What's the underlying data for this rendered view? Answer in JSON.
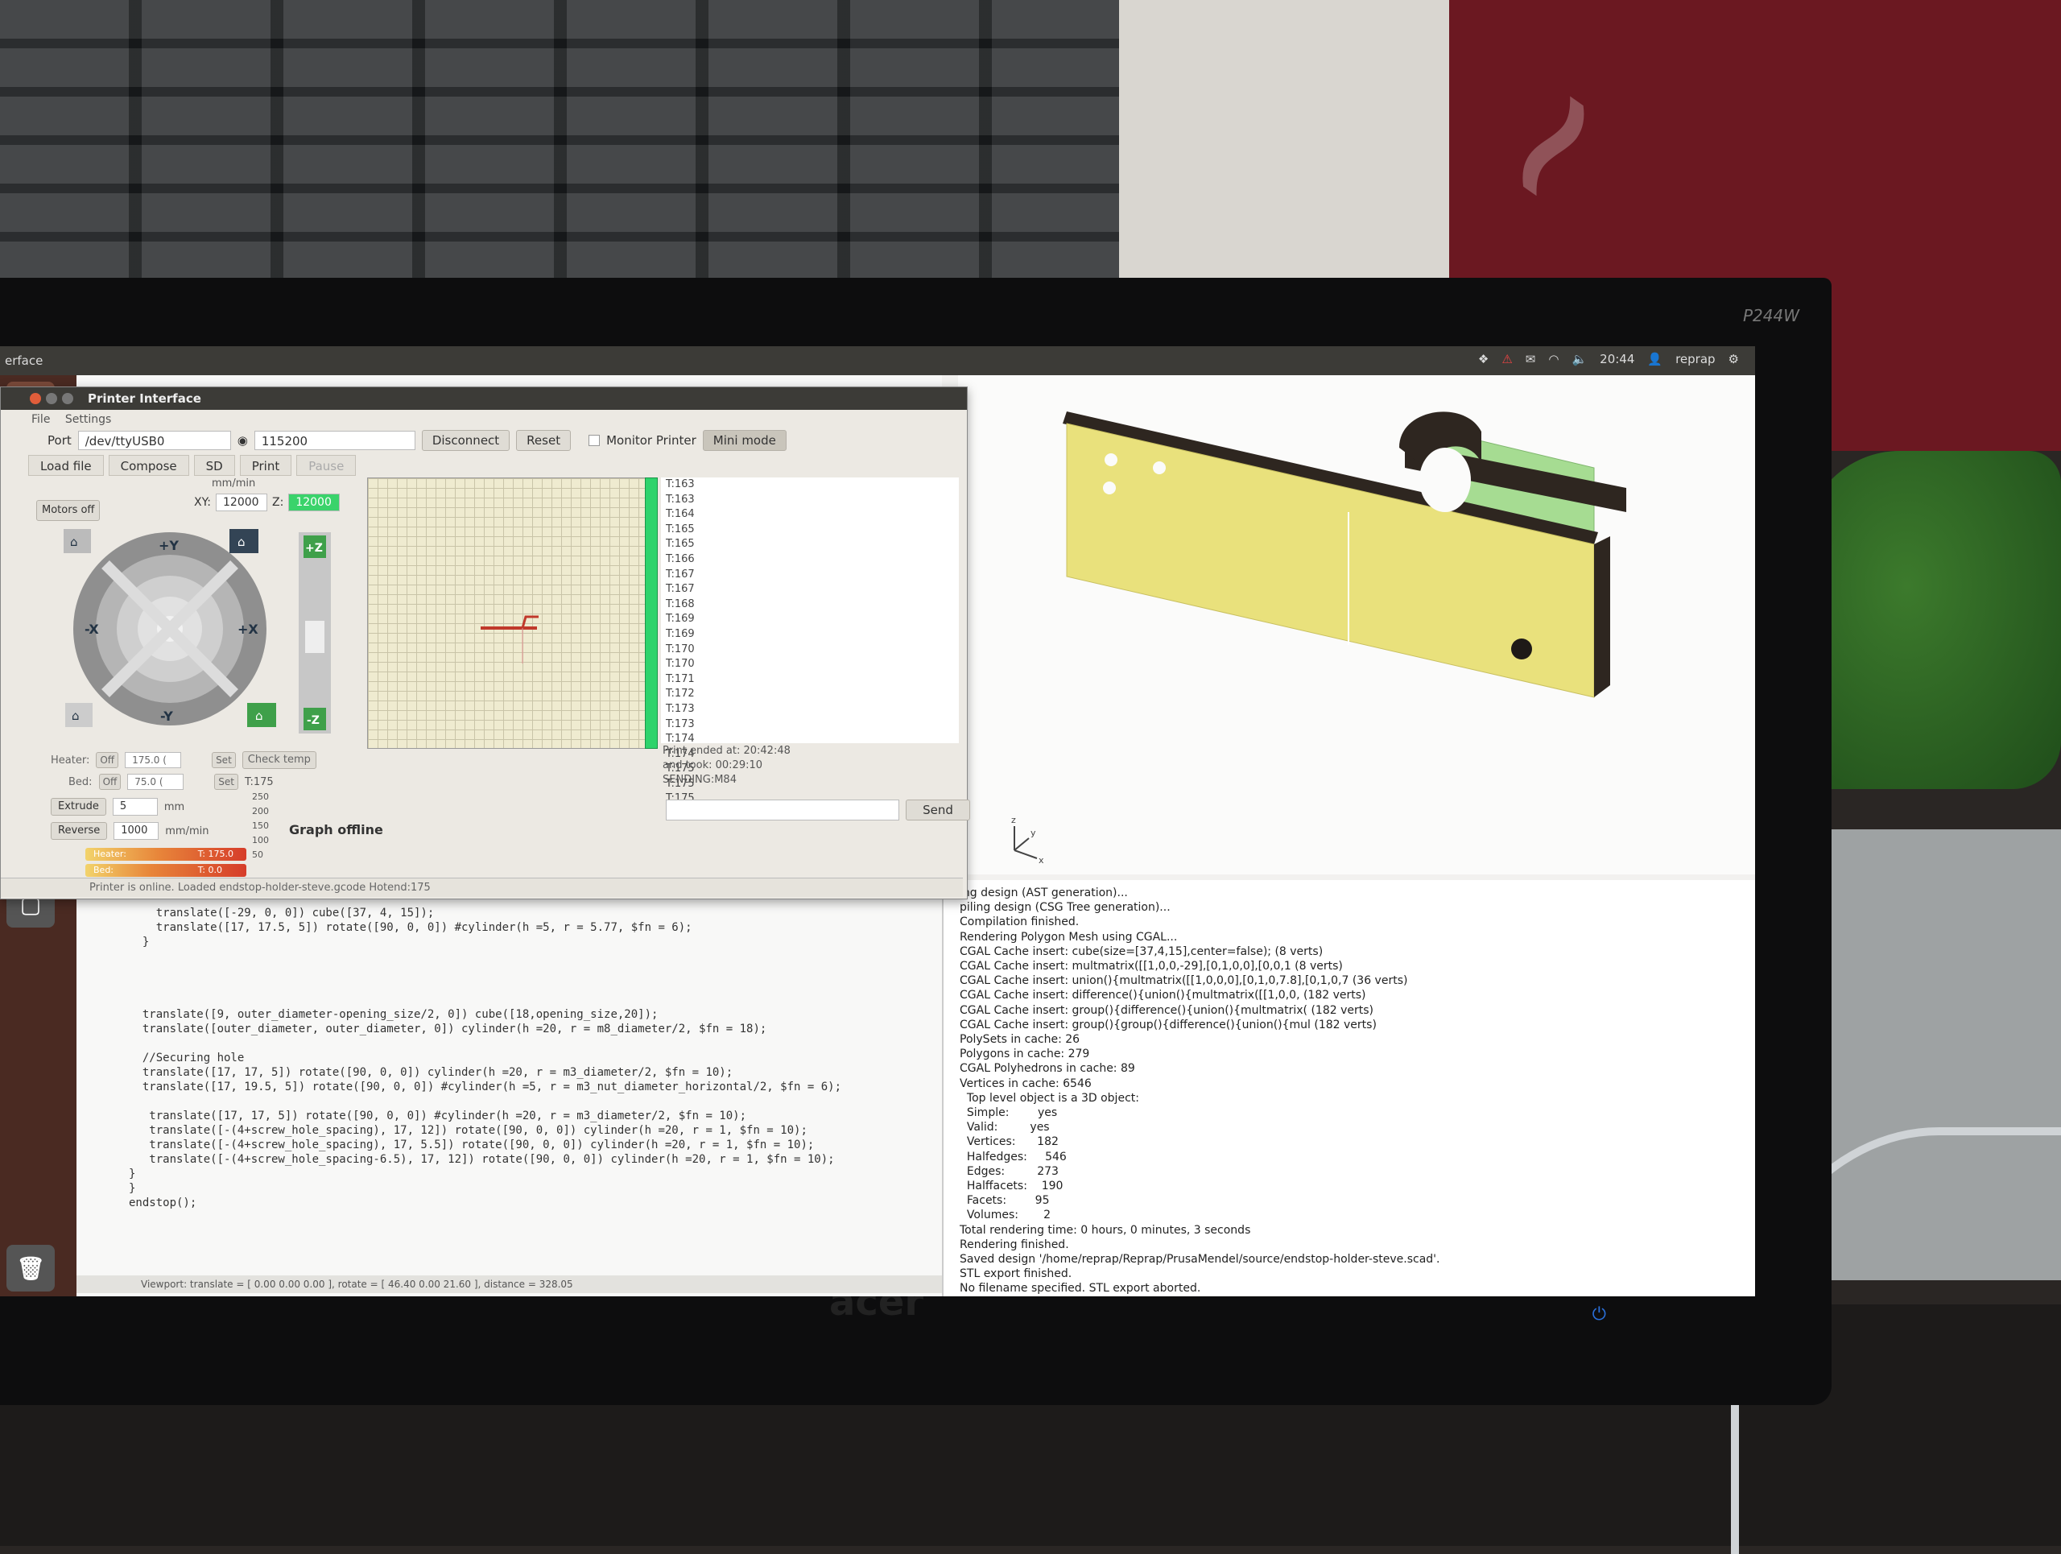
{
  "top_panel": {
    "title": "erface",
    "clock": "20:44",
    "user": "reprap"
  },
  "monitor": {
    "model": "P244W",
    "brand": "acer"
  },
  "pronterface": {
    "window_title": "Printer Interface",
    "menu": [
      "File",
      "Settings"
    ],
    "port_label": "Port",
    "port_value": "/dev/ttyUSB0",
    "baud_value": "115200",
    "disconnect_label": "Disconnect",
    "reset_label": "Reset",
    "monitor_printer_label": "Monitor Printer",
    "mini_mode_label": "Mini mode",
    "tabs": {
      "load_file": "Load file",
      "compose": "Compose",
      "sd": "SD",
      "print": "Print",
      "pause": "Pause"
    },
    "feed_unit": "mm/min",
    "xy_label": "XY:",
    "xy_value": "12000",
    "z_label": "Z:",
    "z_value": "12000",
    "motors_off_label": "Motors off",
    "jog": {
      "plus_y": "+Y",
      "minus_y": "-Y",
      "plus_x": "+X",
      "minus_x": "-X",
      "plus_z": "+Z",
      "minus_z": "-Z"
    },
    "heater_label": "Heater:",
    "heater_off": "Off",
    "heater_value": "175.0 (",
    "bed_label": "Bed:",
    "bed_off": "Off",
    "bed_value": "75.0 (",
    "set_label": "Set",
    "check_temp_label": "Check temp",
    "temp_readout": "T:175",
    "extrude_label": "Extrude",
    "extrude_value": "5",
    "extrude_unit": "mm",
    "reverse_label": "Reverse",
    "reverse_value": "1000",
    "reverse_unit": "mm/min",
    "graph_scale": [
      "250",
      "200",
      "150",
      "100",
      "50"
    ],
    "graph_offline_label": "Graph offline",
    "heater_gauge_label": "Heater:",
    "heater_gauge_value": "T: 175.0",
    "bed_gauge_label": "Bed:",
    "bed_gauge_value": "T: 0.0",
    "log_lines": [
      "T:163",
      "T:163",
      "T:164",
      "T:165",
      "T:165",
      "T:166",
      "T:167",
      "T:167",
      "T:168",
      "T:169",
      "T:169",
      "T:170",
      "T:170",
      "T:171",
      "T:172",
      "T:173",
      "T:173",
      "T:174",
      "T:174",
      "T:175",
      "T:175",
      "T:175"
    ],
    "print_ended": "Print ended at: 20:42:48",
    "took": "and took: 00:29:10",
    "sending": "SENDING:M84",
    "send_label": "Send",
    "status": "Printer is online. Loaded endstop-holder-steve.gcode Hotend:175"
  },
  "editor": {
    "code_lines": [
      "    translate([-29, 0, 0]) cube([37, 4, 15]);",
      "    translate([17, 17.5, 5]) rotate([90, 0, 0]) #cylinder(h =5, r = 5.77, $fn = 6);",
      "  }",
      "",
      "",
      "",
      "",
      "  translate([9, outer_diameter-opening_size/2, 0]) cube([18,opening_size,20]);",
      "  translate([outer_diameter, outer_diameter, 0]) cylinder(h =20, r = m8_diameter/2, $fn = 18);",
      "",
      "  //Securing hole",
      "  translate([17, 17, 5]) rotate([90, 0, 0]) cylinder(h =20, r = m3_diameter/2, $fn = 10);",
      "  translate([17, 19.5, 5]) rotate([90, 0, 0]) #cylinder(h =5, r = m3_nut_diameter_horizontal/2, $fn = 6);",
      "",
      "   translate([17, 17, 5]) rotate([90, 0, 0]) #cylinder(h =20, r = m3_diameter/2, $fn = 10);",
      "   translate([-(4+screw_hole_spacing), 17, 12]) rotate([90, 0, 0]) cylinder(h =20, r = 1, $fn = 10);",
      "   translate([-(4+screw_hole_spacing), 17, 5.5]) rotate([90, 0, 0]) cylinder(h =20, r = 1, $fn = 10);",
      "   translate([-(4+screw_hole_spacing-6.5), 17, 12]) rotate([90, 0, 0]) cylinder(h =20, r = 1, $fn = 10);",
      "}",
      "}",
      "endstop();"
    ],
    "status": "Viewport: translate = [ 0.00 0.00 0.00 ], rotate = [ 46.40 0.00 21.60 ], distance = 328.05"
  },
  "console": {
    "lines": [
      "ing design (AST generation)...",
      "piling design (CSG Tree generation)...",
      "Compilation finished.",
      "Rendering Polygon Mesh using CGAL...",
      "CGAL Cache insert: cube(size=[37,4,15],center=false); (8 verts)",
      "CGAL Cache insert: multmatrix([[1,0,0,-29],[0,1,0,0],[0,0,1 (8 verts)",
      "CGAL Cache insert: union(){multmatrix([[1,0,0,0],[0,1,0,7.8],[0,1,0,7 (36 verts)",
      "CGAL Cache insert: difference(){union(){multmatrix([[1,0,0, (182 verts)",
      "CGAL Cache insert: group(){difference(){union(){multmatrix( (182 verts)",
      "CGAL Cache insert: group(){group(){difference(){union(){mul (182 verts)",
      "PolySets in cache: 26",
      "Polygons in cache: 279",
      "CGAL Polyhedrons in cache: 89",
      "Vertices in cache: 6546",
      "  Top level object is a 3D object:",
      "  Simple:        yes",
      "  Valid:         yes",
      "  Vertices:      182",
      "  Halfedges:     546",
      "  Edges:         273",
      "  Halffacets:    190",
      "  Facets:        95",
      "  Volumes:       2",
      "Total rendering time: 0 hours, 0 minutes, 3 seconds",
      "Rendering finished.",
      "Saved design '/home/reprap/Reprap/PrusaMendel/source/endstop-holder-steve.scad'.",
      "STL export finished.",
      "No filename specified. STL export aborted."
    ]
  },
  "viewer": {
    "axis_z": "z",
    "axis_y": "y",
    "axis_x": "x"
  },
  "colors": {
    "model_face": "#e9e17c",
    "model_edge": "#2e2620",
    "model_green": "#a6dc92",
    "graph_bar": "#2ed36b",
    "panel_dark": "#3c3b37"
  }
}
